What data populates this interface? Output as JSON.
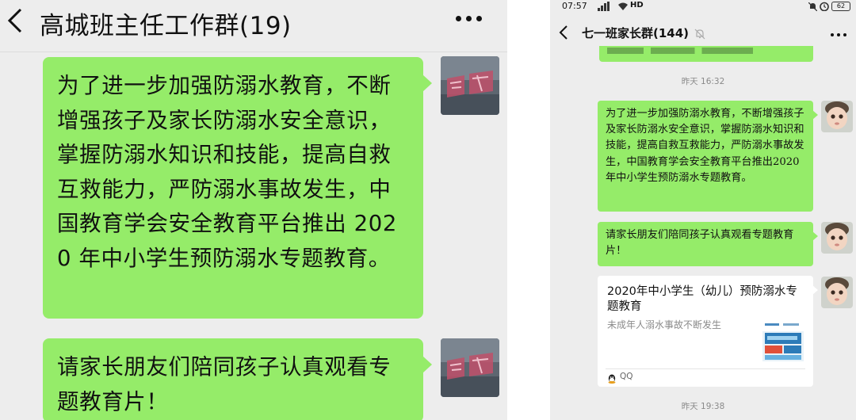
{
  "left_screen": {
    "header": {
      "title": "高城班主任工作群(19)"
    },
    "messages": [
      {
        "text": "为了进一步加强防溺水教育，不断增强孩子及家长防溺水安全意识，掌握防溺水知识和技能，提高自救互救能力，严防溺水事故发生，中国教育学会安全教育平台推出 2020 年中小学生预防溺水专题教育。"
      },
      {
        "text": "请家长朋友们陪同孩子认真观看专题教育片！"
      }
    ]
  },
  "right_screen": {
    "status_bar": {
      "time": "07:57",
      "network": "HD",
      "battery": "62"
    },
    "header": {
      "title": "七一班家长群(144)"
    },
    "timestamps": [
      "昨天 16:32",
      "昨天 19:38"
    ],
    "messages": [
      {
        "text": "为了进一步加强防溺水教育，不断增强孩子及家长防溺水安全意识，掌握防溺水知识和技能，提高自救互救能力，严防溺水事故发生，中国教育学会安全教育平台推出2020年中小学生预防溺水专题教育。"
      },
      {
        "text": "请家长朋友们陪同孩子认真观看专题教育片！"
      }
    ],
    "link_card": {
      "title": "2020年中小学生（幼儿）预防溺水专题教育",
      "description": "未成年人溺水事故不断发生",
      "source": "QQ"
    }
  },
  "colors": {
    "bubble_green": "#95ec69",
    "background": "#ededed",
    "card_white": "#ffffff"
  },
  "icons": [
    "back-arrow-icon",
    "more-icon",
    "mute-bell-icon",
    "signal-icon",
    "wifi-icon",
    "alarm-icon",
    "battery-icon",
    "qq-icon"
  ]
}
